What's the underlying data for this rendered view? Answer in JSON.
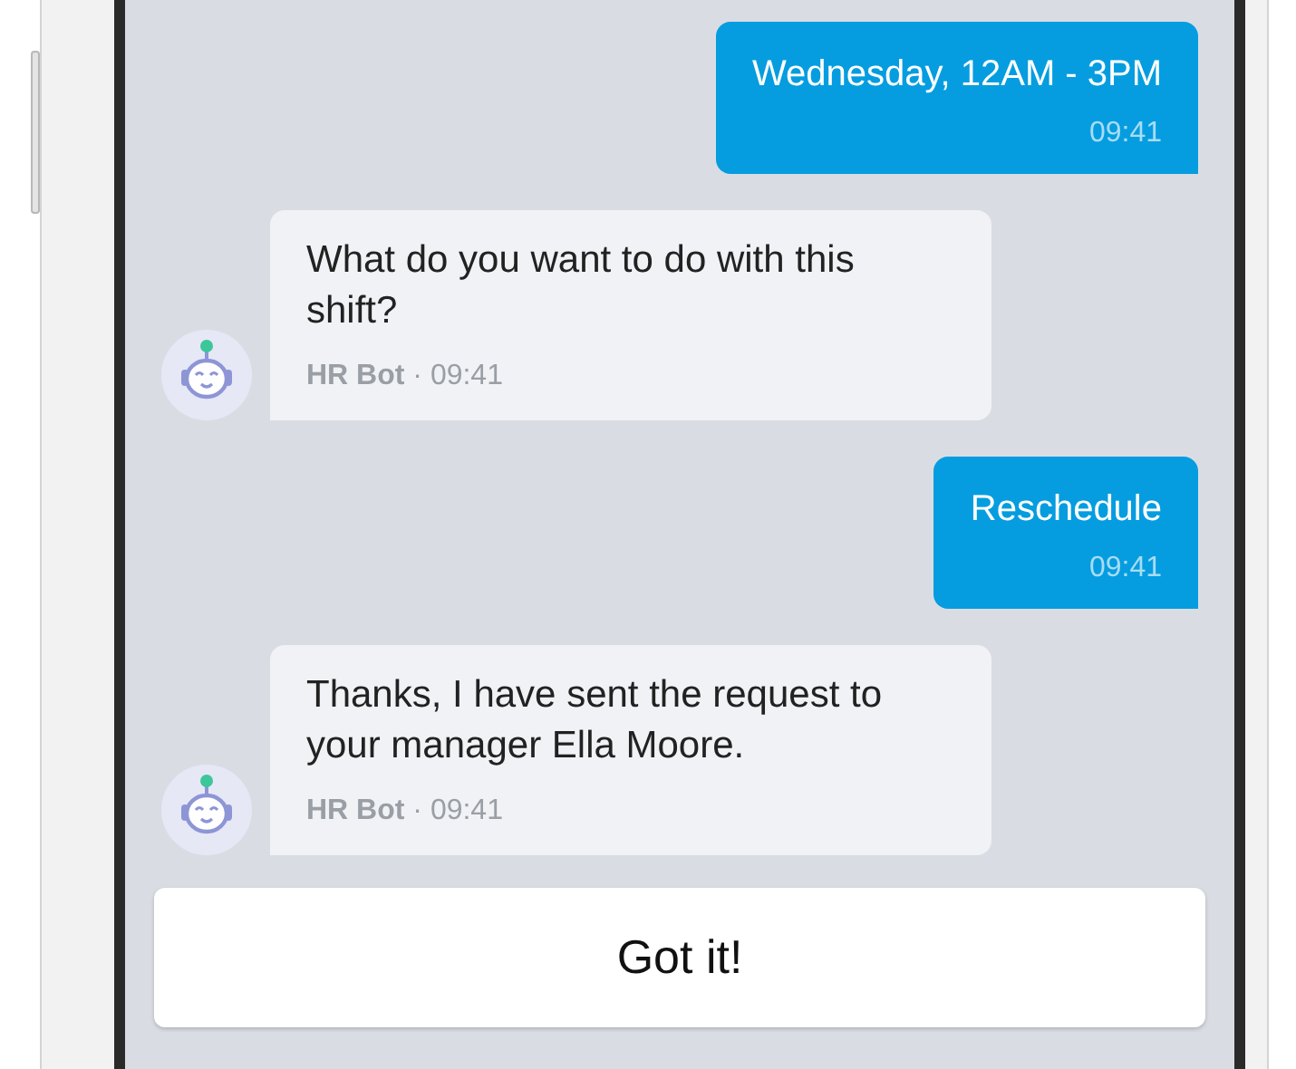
{
  "messages": [
    {
      "kind": "user",
      "text": "Wednesday, 12AM - 3PM",
      "time": "09:41"
    },
    {
      "kind": "bot",
      "text": "What do you want to do with this shift?",
      "meta": "**HR Bot** · 09:41"
    },
    {
      "kind": "user",
      "text": "Reschedule",
      "time": "09:41"
    },
    {
      "kind": "bot",
      "text": "Thanks, I have sent the request to your manager Ella Moore.",
      "meta": "**HR Bot** · 09:41"
    }
  ],
  "action_button": "Got it!"
}
